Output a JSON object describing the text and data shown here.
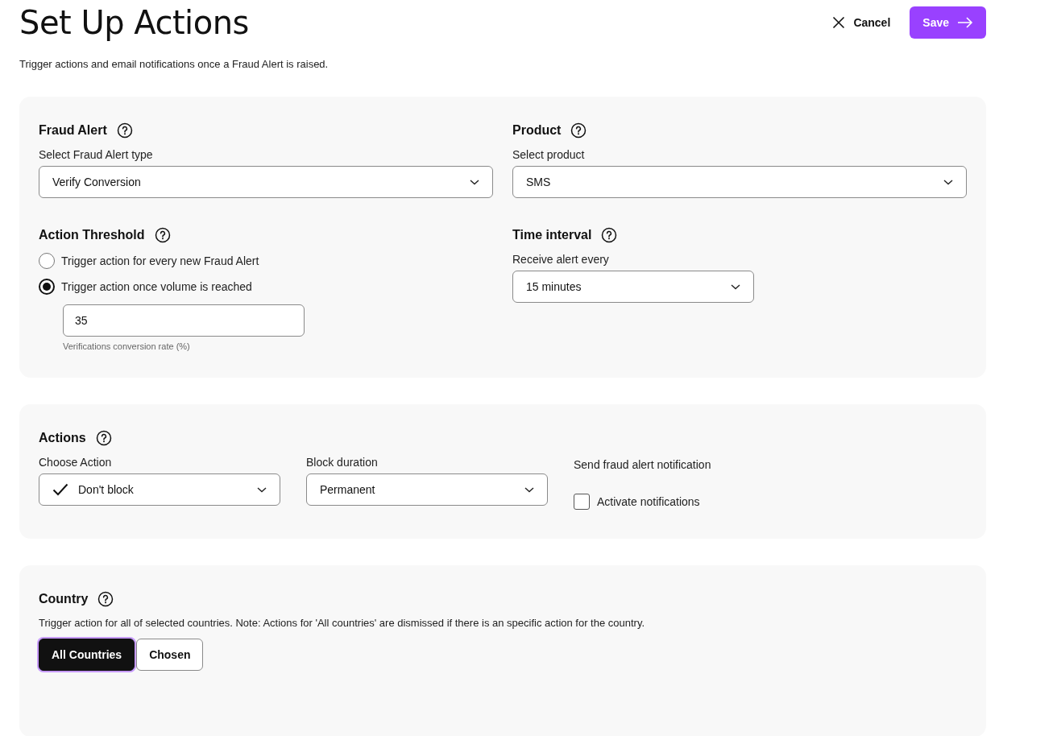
{
  "page": {
    "title": "Set Up Actions",
    "subtitle": "Trigger actions and email notifications once a Fraud Alert is raised."
  },
  "header_actions": {
    "cancel": "Cancel",
    "save": "Save"
  },
  "alert_card": {
    "fraud_alert": {
      "heading": "Fraud Alert",
      "label": "Select Fraud Alert type",
      "value": "Verify Conversion"
    },
    "product": {
      "heading": "Product",
      "label": "Select product",
      "value": "SMS"
    },
    "threshold": {
      "heading": "Action Threshold",
      "options": [
        {
          "label": "Trigger action for every new Fraud Alert",
          "selected": false
        },
        {
          "label": "Trigger action once volume is reached",
          "selected": true
        }
      ],
      "input": {
        "value": "35",
        "helper": "Verifications conversion rate (%)"
      }
    },
    "time_interval": {
      "heading": "Time interval",
      "label": "Receive alert every",
      "value": "15 minutes"
    }
  },
  "actions_card": {
    "heading": "Actions",
    "choose_action": {
      "label": "Choose Action",
      "value": "Don't block"
    },
    "block_duration": {
      "label": "Block duration",
      "value": "Permanent"
    },
    "notification": {
      "label": "Send fraud alert notification",
      "checkbox": {
        "label": "Activate notifications",
        "checked": false
      }
    }
  },
  "country_card": {
    "heading": "Country",
    "description": "Trigger action for all of selected countries. Note: Actions for 'All countries' are dismissed if there is an specific action for the country.",
    "toggle": [
      {
        "label": "All Countries",
        "selected": true
      },
      {
        "label": "Chosen",
        "selected": false
      }
    ]
  }
}
